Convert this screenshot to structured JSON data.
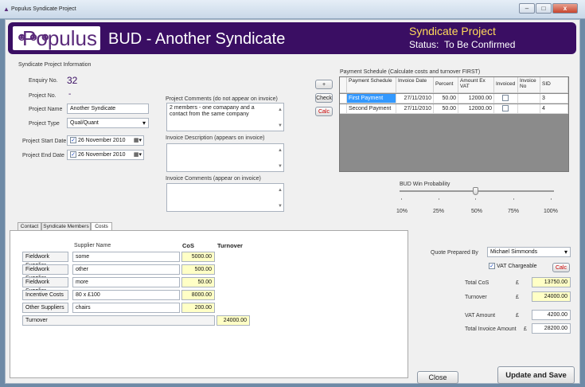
{
  "window": {
    "title": "Populus Syndicate Project"
  },
  "banner": {
    "logo": "Populus",
    "title": "BUD - Another Syndicate",
    "project_label": "Syndicate Project",
    "status_label": "Status:",
    "status_value": "To Be Confirmed"
  },
  "info": {
    "section_title": "Syndicate Project Information",
    "enquiry_label": "Enquiry No.",
    "enquiry_value": "32",
    "project_no_label": "Project No.",
    "project_no_value": "-",
    "project_name_label": "Project Name",
    "project_name_value": "Another Syndicate",
    "project_type_label": "Project Type",
    "project_type_value": "Qual/Quant",
    "start_label": "Project Start Date",
    "start_value": "26 November 2010",
    "end_label": "Project End Date",
    "end_value": "26 November 2010"
  },
  "comments": {
    "project_label": "Project Comments (do not appear on invoice)",
    "project_value": "2 members - one comapany and a contact from the same company",
    "invoice_desc_label": "Invoice Description (appears on invoice)",
    "invoice_comments_label": "Invoice Comments (appear on invoice)"
  },
  "buttons": {
    "add": "+",
    "check": "Check",
    "calc": "Calc",
    "calc2": "Calc",
    "close": "Close",
    "update": "Update and Save"
  },
  "payment": {
    "title": "Payment Schedule (Calculate costs and turnover FIRST)",
    "headers": [
      "Payment Schedule",
      "Invoice Date",
      "Percent",
      "Amount Ex VAT",
      "Invoiced",
      "Invoice No",
      "SID"
    ],
    "rows": [
      [
        "First Payment",
        "27/11/2010",
        "50.00",
        "12000.00",
        "",
        "",
        "3"
      ],
      [
        "Second Payment",
        "27/11/2010",
        "50.00",
        "12000.00",
        "",
        "",
        "4"
      ]
    ]
  },
  "probability": {
    "label": "BUD Win Probability",
    "value_percent": 50,
    "ticks": [
      "10%",
      "25%",
      "50%",
      "75%",
      "100%"
    ]
  },
  "tabs": [
    "Contact",
    "Syndicate Members",
    "Costs"
  ],
  "costs": {
    "supplier_header": "Supplier Name",
    "cos_header": "CoS",
    "turnover_header": "Turnover",
    "rows": [
      {
        "label": "Fieldwork Supplier",
        "supplier": "some",
        "cos": "5000.00"
      },
      {
        "label": "Fieldwork Supplier",
        "supplier": "other",
        "cos": "500.00"
      },
      {
        "label": "Fieldwork Supplier",
        "supplier": "more",
        "cos": "50.00"
      },
      {
        "label": "Incentive Costs",
        "supplier": "80 x £100",
        "cos": "8000.00"
      },
      {
        "label": "Other Suppliers",
        "supplier": "chairs",
        "cos": "200.00"
      }
    ],
    "turnover_label": "Turnover",
    "turnover_value": "24000.00"
  },
  "quote": {
    "prepared_label": "Quote Prepared By",
    "prepared_value": "Michael Simmonds",
    "vat_label": "VAT Chargeable",
    "total_cos_label": "Total CoS",
    "total_cos_value": "13750.00",
    "turnover_label": "Turnover",
    "turnover_value": "24000.00",
    "vat_amount_label": "VAT Amount",
    "vat_amount_value": "4200.00",
    "total_invoice_label": "Total Invoice Amount",
    "total_invoice_value": "28200.00",
    "currency": "£"
  },
  "colors": {
    "banner": "#3a0e63",
    "accent": "#ffd95a",
    "highlight": "#ffffc6",
    "selected": "#3399ff"
  }
}
